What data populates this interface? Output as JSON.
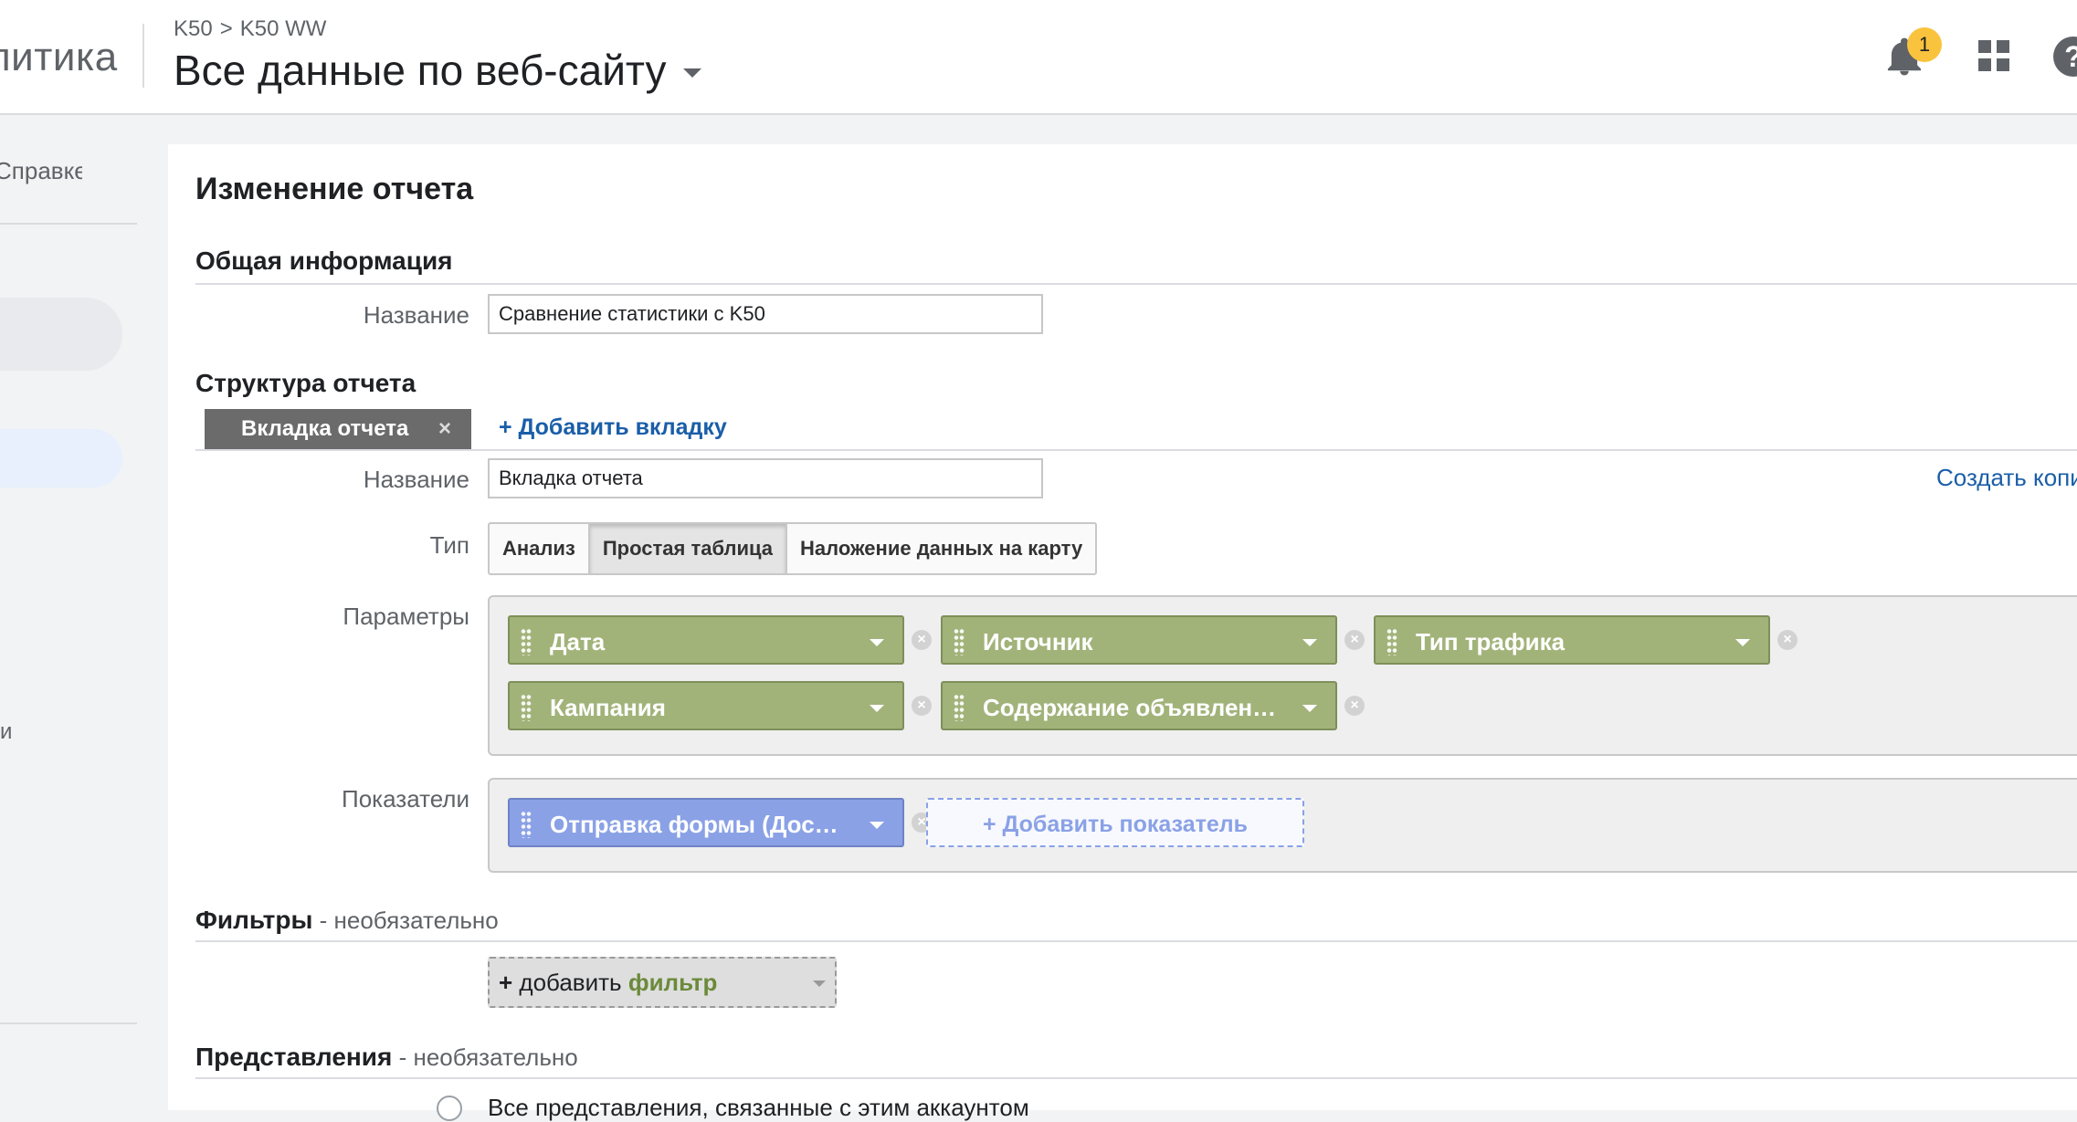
{
  "header": {
    "app_name": "литика",
    "breadcrumb": {
      "account": "K50",
      "separator": ">",
      "property": "K50 WW"
    },
    "view_title": "Все данные по веб-сайту",
    "notification_count": "1",
    "help_icon": "?"
  },
  "sidebar": {
    "help_text": "Справке",
    "partial_label": "и"
  },
  "editor": {
    "title": "Изменение отчета",
    "general_section": "Общая информация",
    "name_label": "Название",
    "report_name": "Сравнение статистики с K50",
    "structure_section": "Структура отчета",
    "tab_label": "Вкладка отчета",
    "tab_close": "×",
    "add_tab": "+ Добавить вкладку",
    "tab_name_label": "Название",
    "tab_name": "Вкладка отчета",
    "copy_link": "Создать копи",
    "type_label": "Тип",
    "types": [
      "Анализ",
      "Простая таблица",
      "Наложение данных на карту"
    ],
    "selected_type": "Простая таблица",
    "params_label": "Параметры",
    "dimensions": [
      "Дата",
      "Источник",
      "Тип трафика",
      "Кампания",
      "Содержание объявлен…"
    ],
    "metrics_label": "Показатели",
    "metrics": [
      "Отправка формы (Дос…"
    ],
    "add_metric": "+ Добавить показатель",
    "filters_title": "Фильтры",
    "optional": " - необязательно",
    "add_filter_plus": "+",
    "add_filter_text": " добавить ",
    "add_filter_word": "фильтр",
    "views_title": "Представления",
    "views_option": "Все представления, связанные с этим аккаунтом"
  },
  "colors": {
    "dimension_chip": "#a2b37a",
    "metric_chip": "#8aa1e6",
    "link": "#1a5ea8",
    "badge": "#f9c33d"
  },
  "icons": [
    "bell-icon",
    "apps-grid-icon",
    "help-icon",
    "chevron-down-icon",
    "drag-handle-icon",
    "remove-icon",
    "close-icon"
  ]
}
